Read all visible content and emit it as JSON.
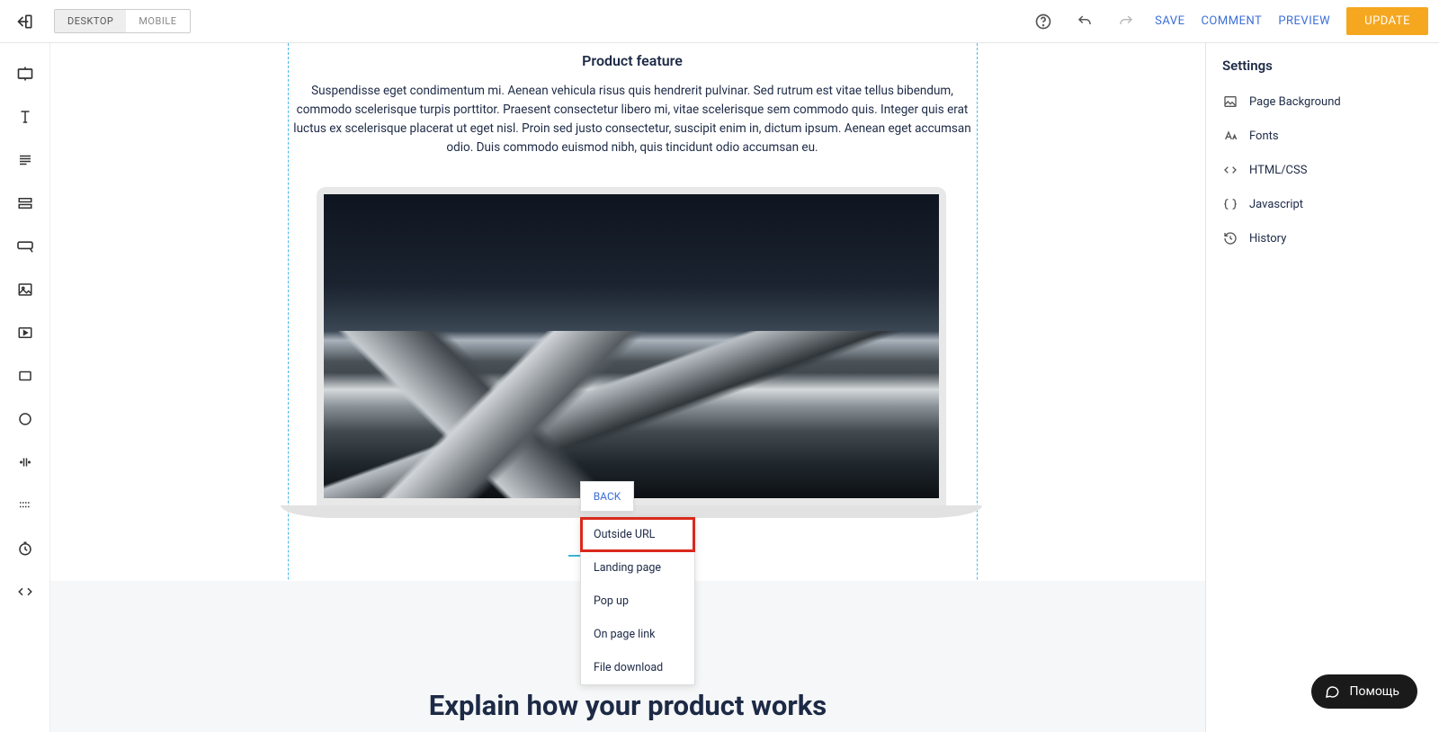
{
  "header": {
    "device": {
      "desktop": "DESKTOP",
      "mobile": "MOBILE"
    },
    "save": "SAVE",
    "comment": "COMMENT",
    "preview": "PREVIEW",
    "update": "UPDATE"
  },
  "canvas": {
    "feature_title": "Product feature",
    "feature_text": "Suspendisse eget condimentum mi. Aenean vehicula risus quis hendrerit pulvinar. Sed rutrum est vitae tellus bibendum, commodo scelerisque turpis porttitor. Praesent consectetur libero mi, vitae scelerisque sem commodo quis. Integer quis erat luctus ex scelerisque placerat ut eget nisl. Proin sed justo consectetur, suscipit enim in, dictum ipsum. Aenean eget accumsan odio. Duis commodo euismod nibh, quis tincidunt odio accumsan eu.",
    "section2_title": "Explain how your product works"
  },
  "popup": {
    "back": "BACK",
    "items": [
      "Outside URL",
      "Landing page",
      "Pop up",
      "On page link",
      "File download"
    ]
  },
  "settings": {
    "title": "Settings",
    "items": [
      "Page Background",
      "Fonts",
      "HTML/CSS",
      "Javascript",
      "History"
    ]
  },
  "help": "Помощь"
}
